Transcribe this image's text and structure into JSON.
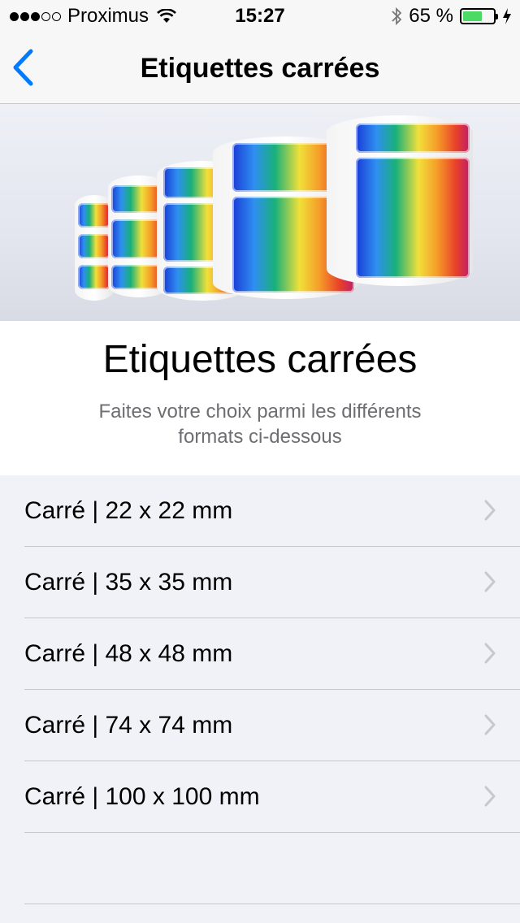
{
  "status_bar": {
    "carrier": "Proximus",
    "time": "15:27",
    "battery": "65 %",
    "battery_level": 0.65,
    "battery_color": "#4cd964"
  },
  "nav": {
    "title": "Etiquettes carrées",
    "back_icon": "chevron-left-icon",
    "accent": "#007aff"
  },
  "intro": {
    "title": "Etiquettes carrées",
    "subtitle": "Faites votre choix parmi les différents formats ci-dessous"
  },
  "formats": [
    {
      "label": "Carré | 22 x 22 mm"
    },
    {
      "label": "Carré | 35 x 35 mm"
    },
    {
      "label": "Carré | 48 x 48 mm"
    },
    {
      "label": "Carré | 74 x 74 mm"
    },
    {
      "label": "Carré | 100 x 100 mm"
    }
  ]
}
